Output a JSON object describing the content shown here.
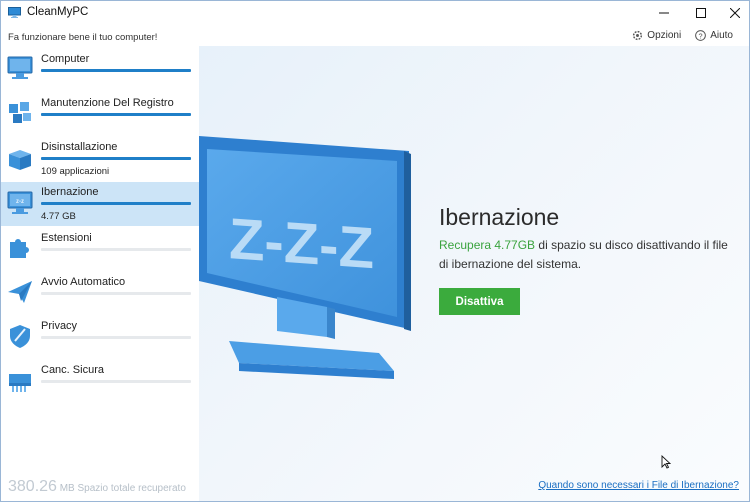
{
  "window": {
    "title": "CleanMyPC"
  },
  "header": {
    "tagline": "Fa funzionare bene il tuo computer!",
    "options_label": "Opzioni",
    "help_label": "Aiuto"
  },
  "sidebar": {
    "items": [
      {
        "label": "Computer",
        "progress": 1.0,
        "sub": ""
      },
      {
        "label": "Manutenzione Del Registro",
        "progress": 1.0,
        "sub": ""
      },
      {
        "label": "Disinstallazione",
        "progress": 1.0,
        "sub": "109 applicazioni"
      },
      {
        "label": "Ibernazione",
        "progress": 1.0,
        "sub": "4.77 GB"
      },
      {
        "label": "Estensioni",
        "progress": 0.0,
        "sub": ""
      },
      {
        "label": "Avvio Automatico",
        "progress": 0.0,
        "sub": ""
      },
      {
        "label": "Privacy",
        "progress": 0.0,
        "sub": ""
      },
      {
        "label": "Canc. Sicura",
        "progress": 0.0,
        "sub": ""
      }
    ],
    "recovered_value": "380.26",
    "recovered_text": "MB Spazio totale recuperato"
  },
  "main": {
    "title": "Ibernazione",
    "desc_highlight": "Recupera 4.77GB",
    "desc_rest": " di spazio su disco disattivando il file di ibernazione del sistema.",
    "button_label": "Disattiva",
    "help_link": "Quando sono necessari i File di Ibernazione?"
  },
  "colors": {
    "accent_blue": "#1f7fc8",
    "active_bg": "#cce4f7",
    "green": "#3bab3d",
    "link": "#1a6ec2"
  }
}
